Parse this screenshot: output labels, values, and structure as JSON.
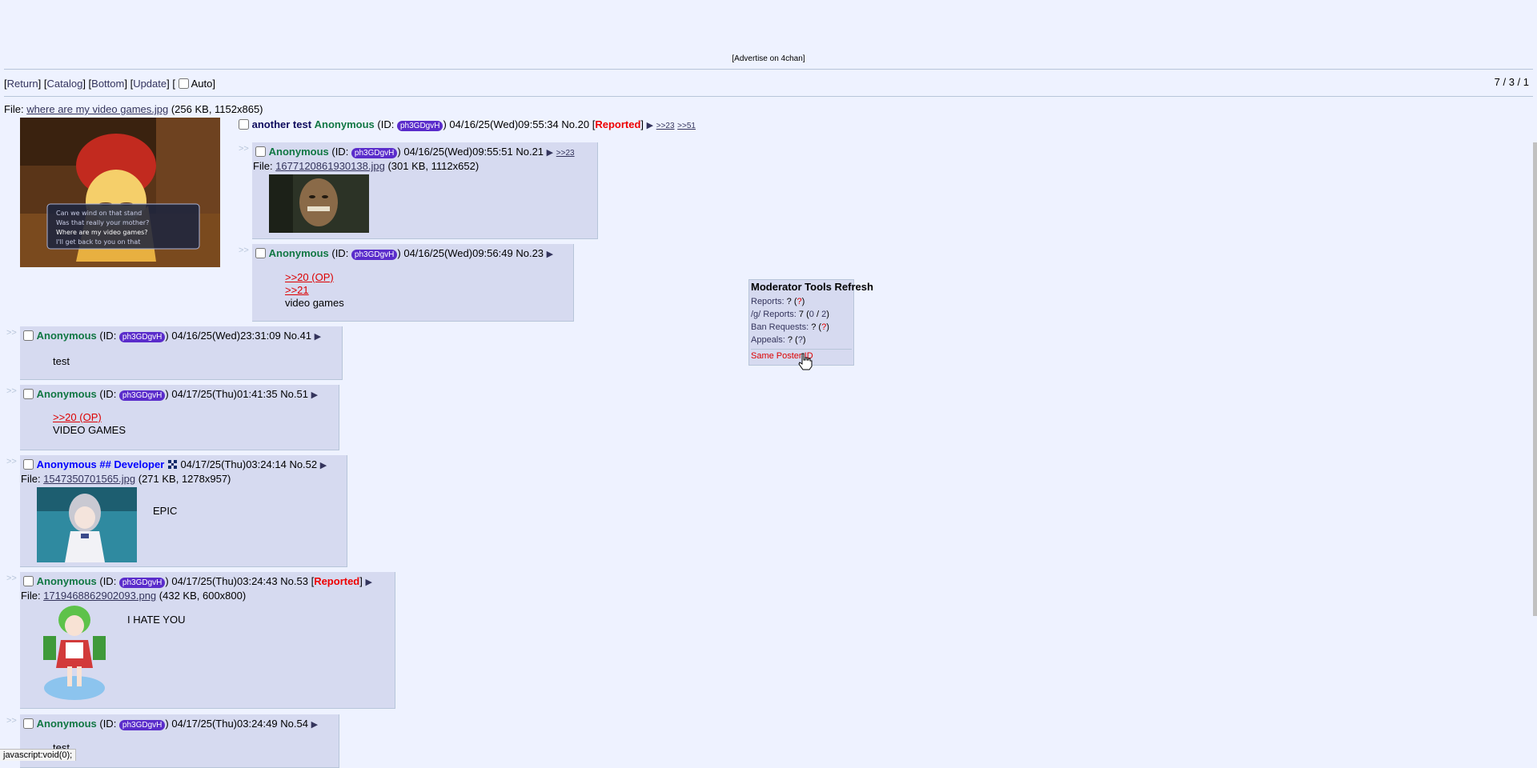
{
  "ad": {
    "text": "[Advertise on 4chan]"
  },
  "nav": {
    "return": "Return",
    "catalog": "Catalog",
    "bottom": "Bottom",
    "update": "Update",
    "auto": "Auto",
    "stats": "7 / 3 / 1"
  },
  "op": {
    "file_label": "File:",
    "file_name": "where are my video games.jpg",
    "file_meta": "(256 KB, 1152x865)",
    "subject": "another test",
    "name": "Anonymous",
    "id_label": "(ID:",
    "id": "ph3GDgvH",
    "datetime": "04/16/25(Wed)09:55:34",
    "no": "No.20",
    "reported": "Reported",
    "backlinks": [
      ">>23",
      ">>51"
    ],
    "thumb_caption_lines": [
      "Can we wind on that stand",
      "Was that really your mother?",
      "Where are my video games?",
      "I'll get back to you on that"
    ]
  },
  "posts": [
    {
      "name": "Anonymous",
      "id": "ph3GDgvH",
      "datetime": "04/16/25(Wed)09:55:51",
      "no": "No.21",
      "backlink": ">>23",
      "file_name": "1677120861930138.jpg",
      "file_meta": "(301 KB, 1112x652)"
    },
    {
      "name": "Anonymous",
      "id": "ph3GDgvH",
      "datetime": "04/16/25(Wed)09:56:49",
      "no": "No.23",
      "quotes": [
        ">>20 (OP)",
        ">>21"
      ],
      "text": "video games"
    },
    {
      "name": "Anonymous",
      "id": "ph3GDgvH",
      "datetime": "04/16/25(Wed)23:31:09",
      "no": "No.41",
      "text": "test"
    },
    {
      "name": "Anonymous",
      "id": "ph3GDgvH",
      "datetime": "04/17/25(Thu)01:41:35",
      "no": "No.51",
      "quotes": [
        ">>20 (OP)"
      ],
      "text": "VIDEO GAMES"
    },
    {
      "name": "Anonymous ## Developer",
      "datetime": "04/17/25(Thu)03:24:14",
      "no": "No.52",
      "file_name": "1547350701565.jpg",
      "file_meta": "(271 KB, 1278x957)",
      "text": "EPIC"
    },
    {
      "name": "Anonymous",
      "id": "ph3GDgvH",
      "datetime": "04/17/25(Thu)03:24:43",
      "no": "No.53",
      "reported": "Reported",
      "file_name": "1719468862902093.png",
      "file_meta": "(432 KB, 600x800)",
      "text": "I HATE YOU"
    },
    {
      "name": "Anonymous",
      "id": "ph3GDgvH",
      "datetime": "04/17/25(Thu)03:24:49",
      "no": "No.54",
      "text": "test"
    }
  ],
  "mod_tools": {
    "title": "Moderator Tools",
    "refresh": "Refresh",
    "reports_label": "Reports:",
    "reports_value": "?",
    "reports_q": "?",
    "g_reports_label": "/g/ Reports:",
    "g_reports_value": "7",
    "g_reports_detail_a": "0",
    "g_reports_detail_b": "2",
    "ban_label": "Ban Requests:",
    "ban_value": "?",
    "ban_q": "?",
    "appeals_label": "Appeals:",
    "appeals_value": "?",
    "appeals_q": "?",
    "same_poster": "Same Poster ID"
  },
  "status_bar": {
    "text": "javascript:void(0);"
  },
  "colors": {
    "background": "#eef2ff",
    "reply_bg": "#d6daf0",
    "name": "#117743",
    "id_badge": "#5a2ccb",
    "quote": "#dd0000"
  }
}
